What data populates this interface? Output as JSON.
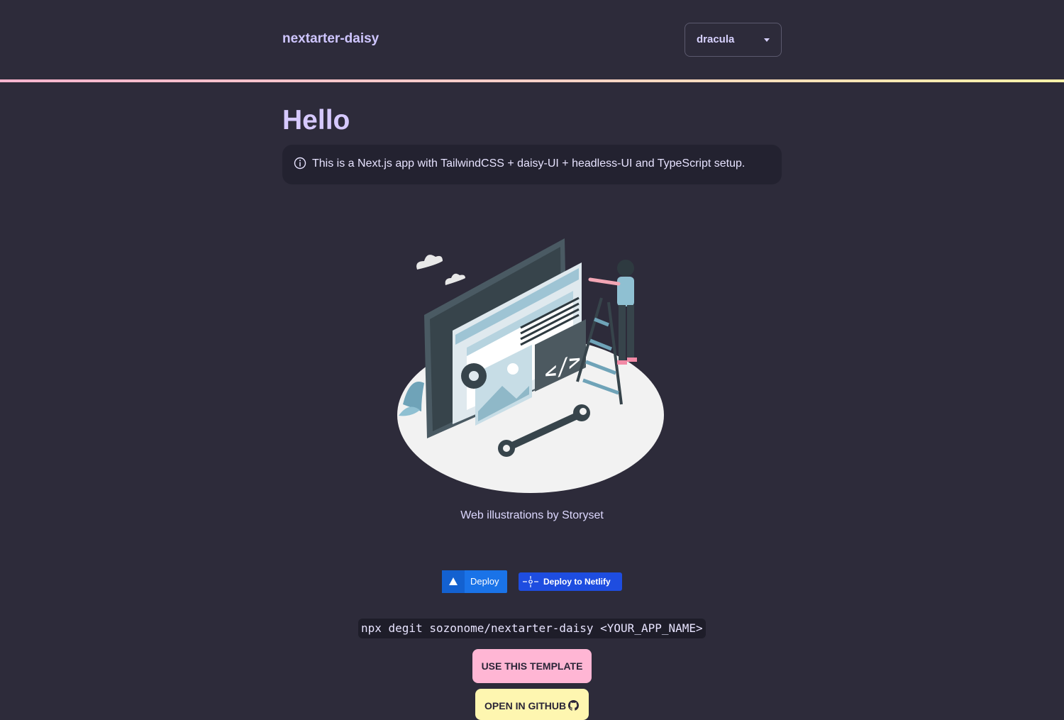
{
  "header": {
    "title": "nextarter-daisy",
    "theme_select": {
      "value": "dracula"
    }
  },
  "main": {
    "heading": "Hello",
    "alert": {
      "icon": "info-icon",
      "text": "This is a Next.js app with TailwindCSS + daisy-UI + headless-UI and TypeScript setup."
    },
    "illustration_credit": "Web illustrations by Storyset",
    "deploy_buttons": {
      "vercel_label": "Deploy",
      "netlify_label": "Deploy to Netlify"
    },
    "command": "npx degit sozonome/nextarter-daisy <YOUR_APP_NAME>",
    "use_template_label": "USE THIS TEMPLATE",
    "open_github_label": "OPEN IN GITHUB"
  },
  "colors": {
    "background": "#2d2b3a",
    "primary": "#ffb6d4",
    "secondary": "#fef6b0",
    "accent_text": "#d6c9ff",
    "vercel_blue": "#1a73e8",
    "netlify_blue": "#1e4de0"
  }
}
